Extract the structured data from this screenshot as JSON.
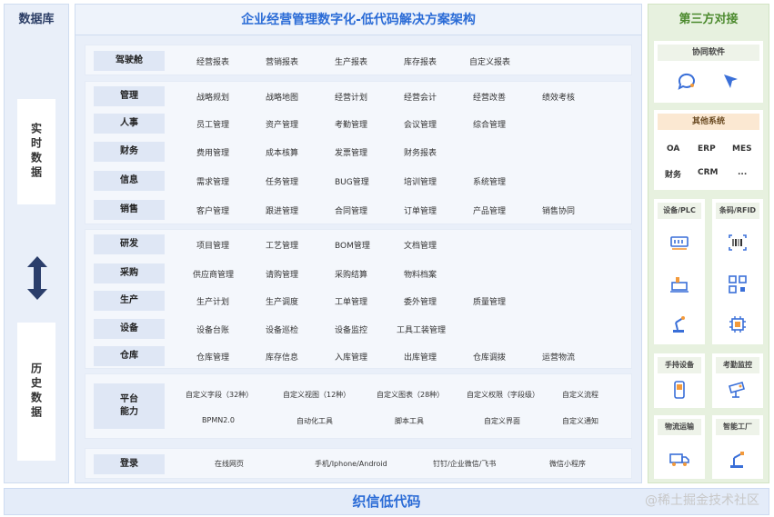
{
  "left": {
    "title": "数据库",
    "realtime": "实时数据",
    "history": "历史数据"
  },
  "center": {
    "title": "企业经营管理数字化-低代码解决方案架构",
    "cockpit": {
      "label": "驾驶舱",
      "items": [
        "经营报表",
        "营销报表",
        "生产报表",
        "库存报表",
        "自定义报表"
      ]
    },
    "groupA": [
      {
        "label": "管理",
        "items": [
          "战略规划",
          "战略地图",
          "经营计划",
          "经营会计",
          "经营改善",
          "绩效考核"
        ]
      },
      {
        "label": "人事",
        "items": [
          "员工管理",
          "资产管理",
          "考勤管理",
          "会议管理",
          "综合管理"
        ]
      },
      {
        "label": "财务",
        "items": [
          "费用管理",
          "成本核算",
          "发票管理",
          "财务报表"
        ]
      },
      {
        "label": "信息",
        "items": [
          "需求管理",
          "任务管理",
          "BUG管理",
          "培训管理",
          "系统管理"
        ]
      },
      {
        "label": "销售",
        "items": [
          "客户管理",
          "跟进管理",
          "合同管理",
          "订单管理",
          "产品管理",
          "销售协同"
        ]
      }
    ],
    "groupB": [
      {
        "label": "研发",
        "items": [
          "项目管理",
          "工艺管理",
          "BOM管理",
          "文档管理"
        ]
      },
      {
        "label": "采购",
        "items": [
          "供应商管理",
          "请购管理",
          "采购结算",
          "物料档案"
        ]
      },
      {
        "label": "生产",
        "items": [
          "生产计划",
          "生产调度",
          "工单管理",
          "委外管理",
          "质量管理"
        ]
      },
      {
        "label": "设备",
        "items": [
          "设备台账",
          "设备巡检",
          "设备监控",
          "工具工装管理"
        ]
      },
      {
        "label": "仓库",
        "items": [
          "仓库管理",
          "库存信息",
          "入库管理",
          "出库管理",
          "仓库调拨",
          "运营物流"
        ]
      }
    ],
    "platform": {
      "label_line1": "平台",
      "label_line2": "能力",
      "row1": [
        "自定义字段（32种）",
        "自定义视图（12种）",
        "自定义图表（28种）",
        "自定义权限（字段级）",
        "自定义流程"
      ],
      "row2": [
        "BPMN2.0",
        "自动化工具",
        "脚本工具",
        "自定义界面",
        "自定义通知"
      ]
    },
    "login": {
      "label": "登录",
      "items": [
        "在线网页",
        "手机/Iphone/Android",
        "钉钉/企业微信/飞书",
        "微信小程序"
      ]
    }
  },
  "right": {
    "title": "第三方对接",
    "collab": {
      "title": "协同软件"
    },
    "other": {
      "title": "其他系统",
      "items": [
        "OA",
        "ERP",
        "MES",
        "财务",
        "CRM",
        "..."
      ]
    },
    "device_plc": {
      "title": "设备/PLC"
    },
    "barcode": {
      "title": "条码/RFID"
    },
    "handheld": {
      "title": "手持设备"
    },
    "attendance": {
      "title": "考勤监控"
    },
    "logistics": {
      "title": "物流运输"
    },
    "smart_factory": {
      "title": "智能工厂"
    }
  },
  "footer": {
    "brand": "织信低代码",
    "watermark": "@稀土掘金技术社区"
  },
  "colors": {
    "accent_blue": "#2a6bd6",
    "accent_green": "#4c8a2e",
    "panel_blue": "#e9eff9",
    "panel_green": "#e7f1df",
    "icon_blue": "#3a6fd8",
    "icon_orange": "#f39a3b"
  }
}
